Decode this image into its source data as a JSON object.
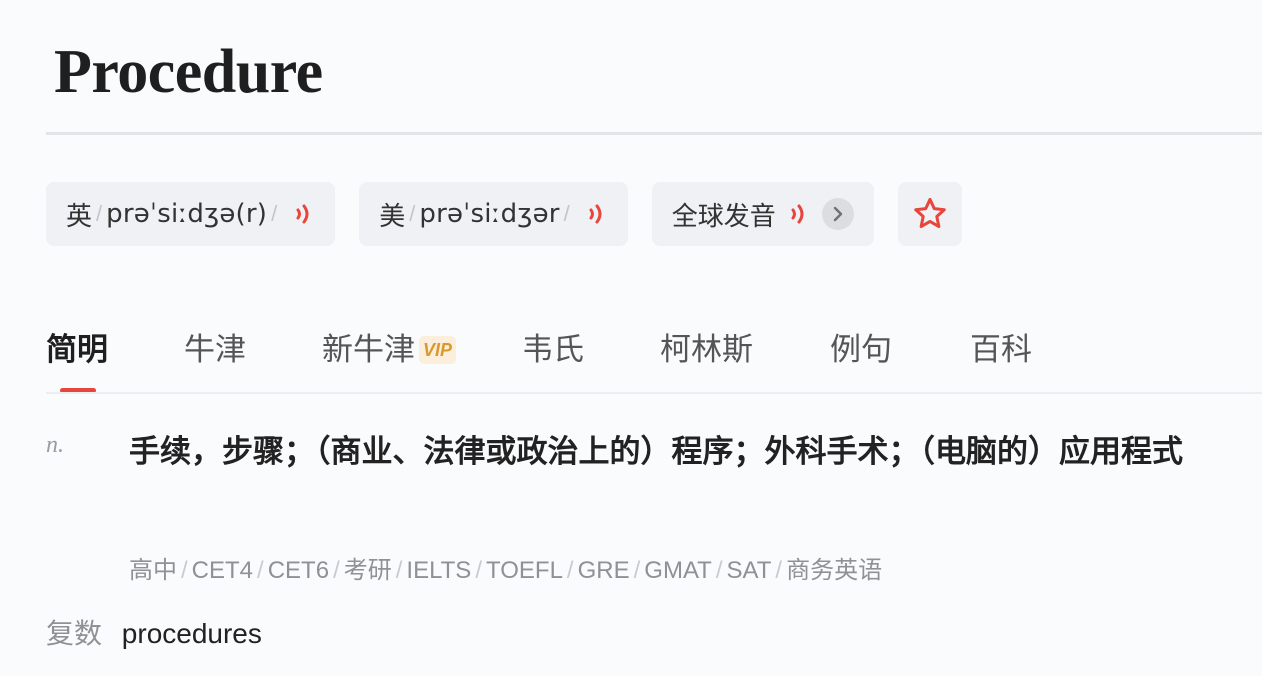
{
  "word": "Procedure",
  "pronunciations": [
    {
      "label": "英",
      "ipa": "prəˈsiːdʒə(r)"
    },
    {
      "label": "美",
      "ipa": "prəˈsiːdʒər"
    }
  ],
  "global_pron": {
    "label": "全球发音"
  },
  "slash": "/",
  "icons": {
    "speaker": "speaker-icon",
    "chevron": "chevron-right-icon",
    "star": "star-icon"
  },
  "colors": {
    "accent": "#e8453c",
    "vip": "#d99a2b"
  },
  "tabs": [
    {
      "label": "简明",
      "active": true
    },
    {
      "label": "牛津"
    },
    {
      "label": "新牛津",
      "badge": "VIP"
    },
    {
      "label": "韦氏"
    },
    {
      "label": "柯林斯"
    },
    {
      "label": "例句"
    },
    {
      "label": "百科"
    }
  ],
  "definition": {
    "pos": "n.",
    "text": "手续，步骤；（商业、法律或政治上的）程序；外科手术；（电脑的）应用程式"
  },
  "exam_tags": [
    "高中",
    "CET4",
    "CET6",
    "考研",
    "IELTS",
    "TOEFL",
    "GRE",
    "GMAT",
    "SAT",
    "商务英语"
  ],
  "plural": {
    "label": "复数",
    "value": "procedures"
  }
}
